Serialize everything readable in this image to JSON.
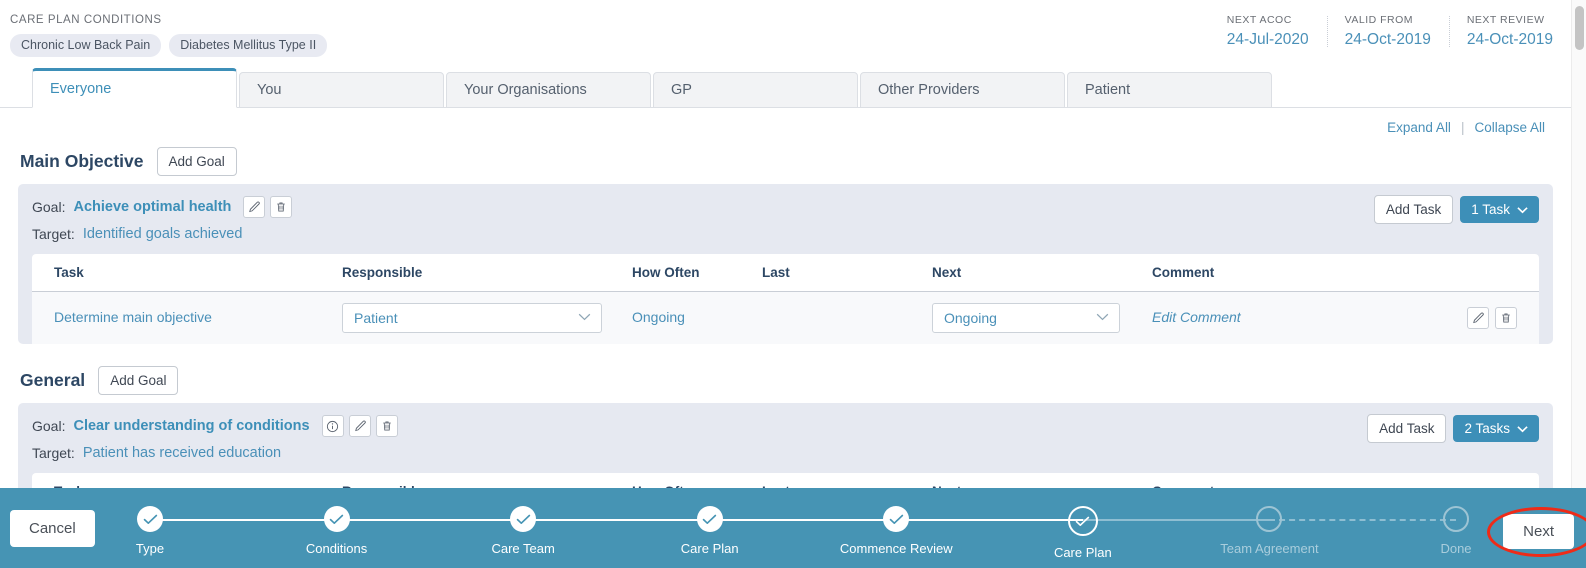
{
  "header": {
    "conditions_label": "CARE PLAN CONDITIONS",
    "conditions": [
      {
        "label": "Chronic Low Back Pain"
      },
      {
        "label": "Diabetes Mellitus Type II"
      }
    ],
    "meta": [
      {
        "key": "NEXT ACOC",
        "value": "24-Jul-2020"
      },
      {
        "key": "VALID FROM",
        "value": "24-Oct-2019"
      },
      {
        "key": "NEXT REVIEW",
        "value": "24-Oct-2019"
      }
    ]
  },
  "tabs": [
    {
      "label": "Everyone",
      "active": true
    },
    {
      "label": "You",
      "active": false
    },
    {
      "label": "Your Organisations",
      "active": false
    },
    {
      "label": "GP",
      "active": false
    },
    {
      "label": "Other Providers",
      "active": false
    },
    {
      "label": "Patient",
      "active": false
    }
  ],
  "toolbar": {
    "expand_all": "Expand All",
    "collapse_all": "Collapse All",
    "divider": "|"
  },
  "table_headers": {
    "task": "Task",
    "responsible": "Responsible",
    "how_often": "How Often",
    "last": "Last",
    "next": "Next",
    "comment": "Comment"
  },
  "labels": {
    "goal_prefix": "Goal:",
    "target_prefix": "Target:",
    "add_goal": "Add Goal",
    "add_task": "Add Task"
  },
  "sections": [
    {
      "title": "Main Objective",
      "add_goal_label": "Add Goal",
      "goal": {
        "name": "Achieve optimal health",
        "target": "Identified goals achieved",
        "has_info_icon": false,
        "add_task_label": "Add Task",
        "task_count_label": "1 Task"
      },
      "rows": [
        {
          "task": "Determine main objective",
          "responsible": "Patient",
          "how_often": "Ongoing",
          "last": "",
          "next": "Ongoing",
          "comment": "Edit Comment"
        }
      ]
    },
    {
      "title": "General",
      "add_goal_label": "Add Goal",
      "goal": {
        "name": "Clear understanding of conditions",
        "target": "Patient has received education",
        "has_info_icon": true,
        "add_task_label": "Add Task",
        "task_count_label": "2 Tasks"
      },
      "rows": []
    }
  ],
  "wizard": {
    "cancel_label": "Cancel",
    "next_label": "Next",
    "steps": [
      {
        "label": "Type",
        "state": "done"
      },
      {
        "label": "Conditions",
        "state": "done"
      },
      {
        "label": "Care Team",
        "state": "done"
      },
      {
        "label": "Care Plan",
        "state": "done"
      },
      {
        "label": "Commence Review",
        "state": "done"
      },
      {
        "label": "Care Plan",
        "state": "current"
      },
      {
        "label": "Team Agreement",
        "state": "todo"
      },
      {
        "label": "Done",
        "state": "todo"
      }
    ]
  },
  "colors": {
    "accent": "#3d8fb8",
    "wizard_bar": "#4694b4",
    "link": "#4a90b8",
    "heading": "#2d4764",
    "card": "#e6e9f1",
    "highlight_ring": "#ee2b18"
  },
  "icons": {
    "edit": "pencil-icon",
    "delete": "trash-icon",
    "info": "info-icon",
    "chevron_down": "chevron-down-icon",
    "check": "check-icon"
  }
}
